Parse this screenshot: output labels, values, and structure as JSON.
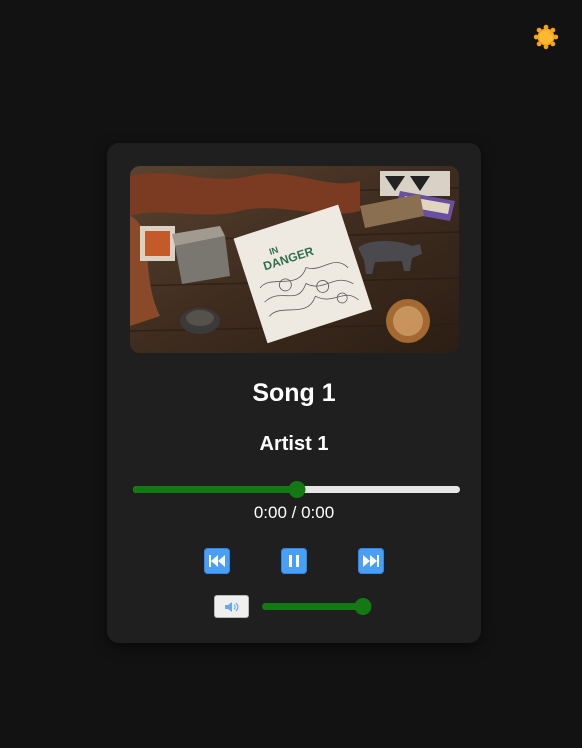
{
  "theme_toggle": {
    "icon": "sun-icon",
    "color": "#f5a31a"
  },
  "player": {
    "album_art": {
      "cover_text": "IN DANGER"
    },
    "song_title": "Song 1",
    "artist": "Artist 1",
    "progress_fraction": 0.5,
    "time_display": "0:00 / 0:00",
    "controls": {
      "previous": {
        "icon": "previous-track-icon"
      },
      "pause": {
        "icon": "pause-icon"
      },
      "next": {
        "icon": "next-track-icon"
      }
    },
    "volume": {
      "icon": "speaker-icon",
      "level_fraction": 0.92
    }
  },
  "colors": {
    "background": "#121212",
    "card": "#1f1f1f",
    "accent_green": "#137a13",
    "button_blue": "#4a9ff5"
  }
}
